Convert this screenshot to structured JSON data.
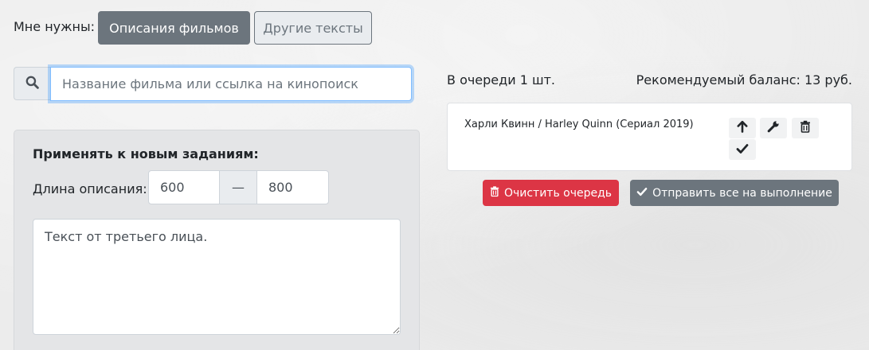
{
  "header": {
    "need_label": "Мне нужны:",
    "mode_buttons": [
      {
        "label": "Описания фильмов",
        "active": true
      },
      {
        "label": "Другие тексты",
        "active": false
      }
    ]
  },
  "search": {
    "placeholder": "Название фильма или ссылка на кинопоиск",
    "value": "",
    "icon": "search-icon"
  },
  "settings": {
    "title": "Применять к новым заданиям:",
    "length_label": "Длина описания:",
    "length_from": "600",
    "length_separator": "—",
    "length_to": "800",
    "description_text": "Текст от третьего лица."
  },
  "queue": {
    "count_text": "В очереди 1 шт.",
    "balance_text": "Рекомендуемый баланс: 13 руб.",
    "items": [
      {
        "title": "Харли Квинн / Harley Quinn (Сериал 2019)",
        "actions": [
          "arrow-up-icon",
          "wrench-icon",
          "trash-icon",
          "check-icon"
        ]
      }
    ],
    "clear_label": "Очистить очередь",
    "send_label": "Отправить все на выполнение"
  },
  "colors": {
    "secondary": "#6c757d",
    "danger": "#dc3545",
    "focus_border": "#80bdff",
    "background": "#ececec"
  }
}
